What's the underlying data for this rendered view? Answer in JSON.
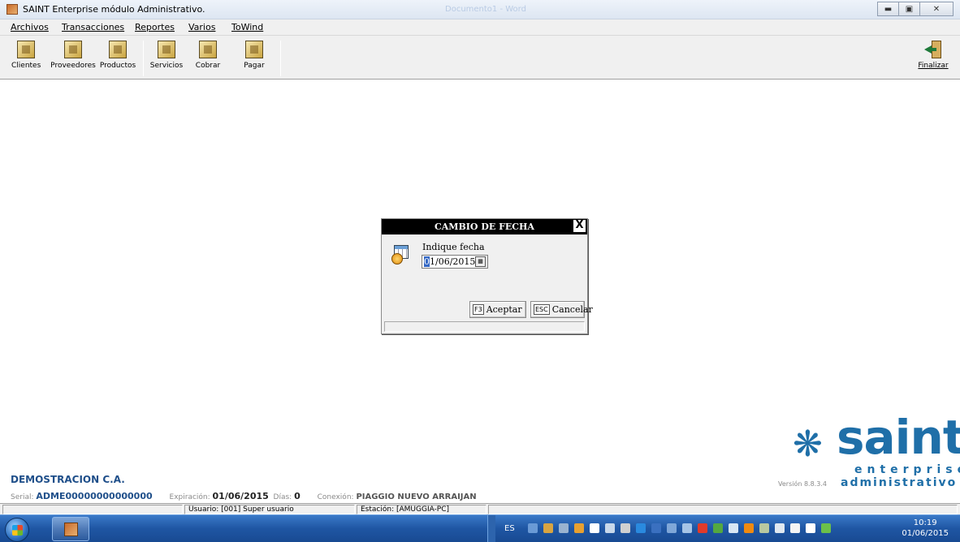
{
  "window": {
    "title": "SAINT Enterprise módulo Administrativo.",
    "faint_title": "Documento1 - Word",
    "controls": [
      "minimize",
      "maximize",
      "close"
    ]
  },
  "menu": [
    "Archivos",
    "Transacciones",
    "Reportes",
    "Varios",
    "ToWind"
  ],
  "toolbar": {
    "items": [
      {
        "label": "Clientes",
        "icon": "clientes-icon"
      },
      {
        "label": "Proveedores",
        "icon": "proveedores-icon"
      },
      {
        "label": "Productos",
        "icon": "productos-icon"
      },
      {
        "label": "Servicios",
        "icon": "servicios-icon"
      },
      {
        "label": "Cobrar",
        "icon": "cobrar-icon"
      },
      {
        "label": "Pagar",
        "icon": "pagar-icon"
      }
    ],
    "exit_label": "Finalizar"
  },
  "dialog": {
    "title": "CAMBIO DE FECHA",
    "close": "X",
    "prompt": "Indique fecha",
    "date_selected": "0",
    "date_rest": "1/06/2015",
    "accept_key": "F3",
    "accept_label": "Aceptar",
    "cancel_key": "ESC",
    "cancel_label": "Cancelar"
  },
  "logo": {
    "word": "saint",
    "sub1": "enterprise",
    "sub2": "administrativo",
    "version": "Versión 8.8.3.4"
  },
  "company": {
    "name": "DEMOSTRACION C.A.",
    "serial_label": "Serial:",
    "serial": "ADME00000000000000",
    "expiration_label": "Expiración:",
    "expiration": "01/06/2015",
    "days_label": "Días:",
    "days": "0",
    "connection_label": "Conexión:",
    "connection": "PIAGGIO NUEVO ARRAIJAN"
  },
  "statusbar": {
    "user": "Usuario: [001]  Super usuario",
    "station": "Estación: [AMUGGIA-PC]"
  },
  "taskbar": {
    "language": "ES",
    "time": "10:19",
    "date": "01/06/2015"
  },
  "colors": {
    "brand": "#1f6fa8",
    "company": "#1f4f8a",
    "taskbar": "#1f56a3"
  }
}
